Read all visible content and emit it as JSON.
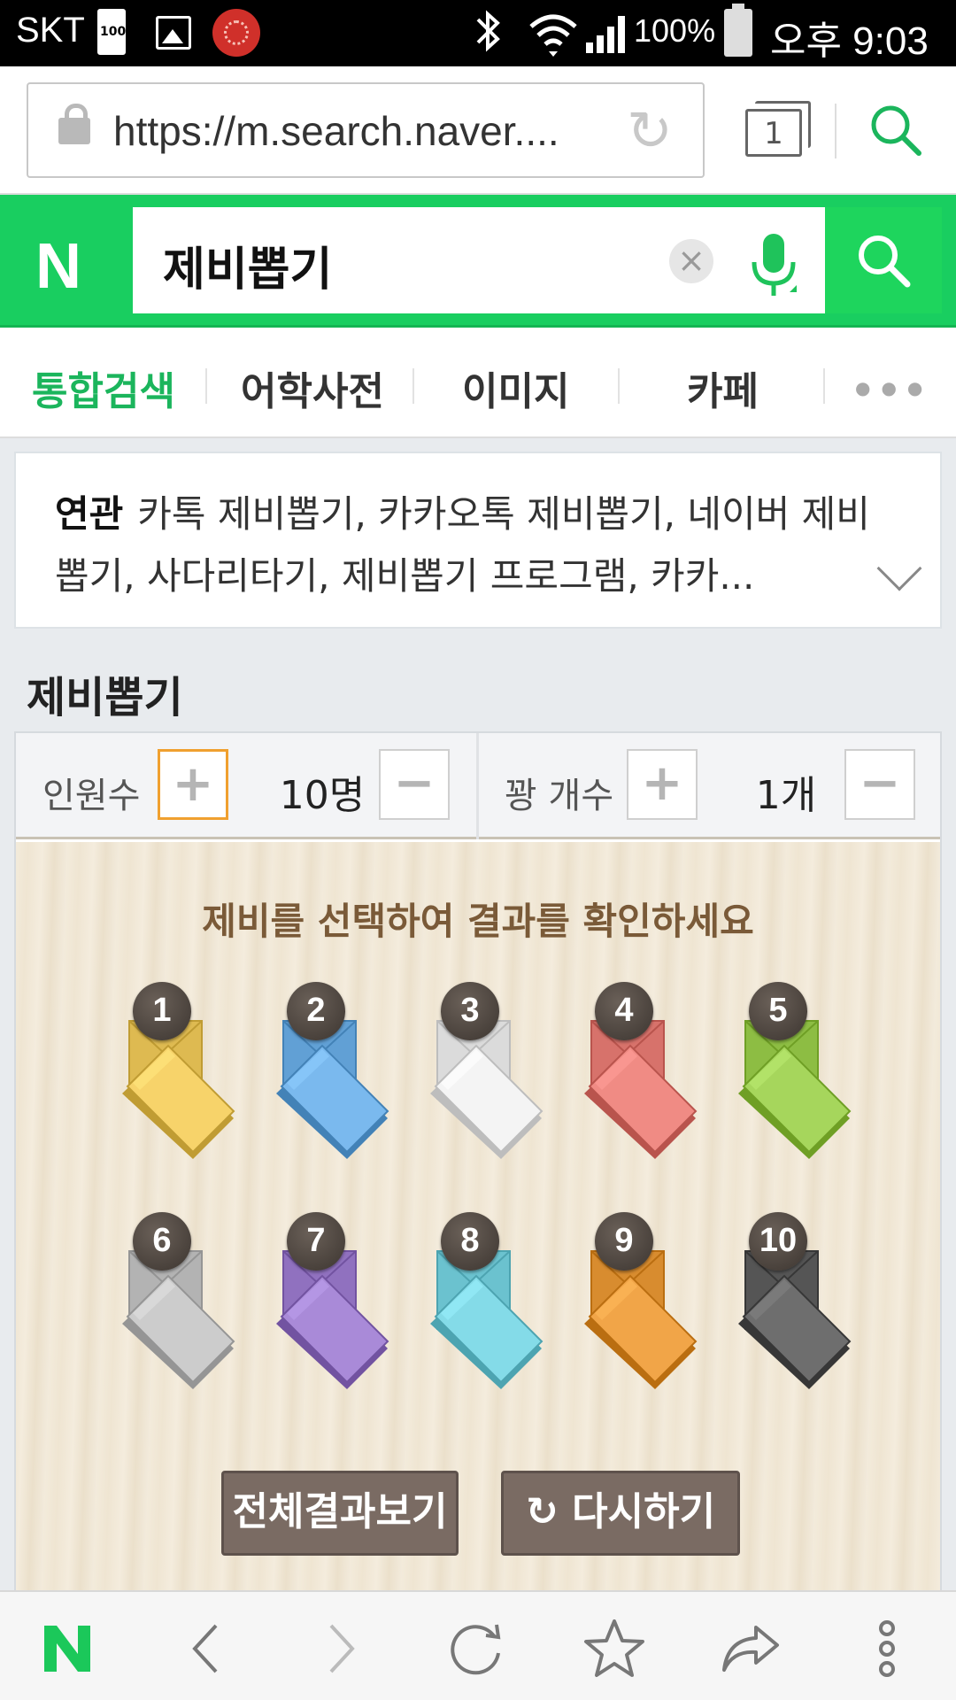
{
  "status_bar": {
    "carrier": "SKT",
    "battery_small": "100",
    "battery_percent": "100%",
    "time": "오후 9:03"
  },
  "browser": {
    "url": "https://m.search.naver....",
    "tab_count": "1"
  },
  "search": {
    "logo": "N",
    "query": "제비뽑기",
    "clear_icon": "×"
  },
  "category_tabs": [
    {
      "label": "통합검색",
      "active": true
    },
    {
      "label": "어학사전",
      "active": false
    },
    {
      "label": "이미지",
      "active": false
    },
    {
      "label": "카페",
      "active": false
    }
  ],
  "related": {
    "label": "연관",
    "text": "카톡 제비뽑기, 카카오톡 제비뽑기, 네이버 제비뽑기, 사다리타기, 제비뽑기 프로그램, 카카..."
  },
  "section_title": "제비뽑기",
  "controls": {
    "people_label": "인원수",
    "people_value": "10명",
    "prize_label": "꽝 개수",
    "prize_value": "1개",
    "plus": "+",
    "minus": "−"
  },
  "board": {
    "instruction": "제비를 선택하여 결과를 확인하세요",
    "swallows": [
      {
        "num": "1",
        "color": "#f7d36a"
      },
      {
        "num": "2",
        "color": "#7ab9ee"
      },
      {
        "num": "3",
        "color": "#f4f4f4"
      },
      {
        "num": "4",
        "color": "#f08b84"
      },
      {
        "num": "5",
        "color": "#a6d65c"
      },
      {
        "num": "6",
        "color": "#cccccc"
      },
      {
        "num": "7",
        "color": "#a98ad8"
      },
      {
        "num": "8",
        "color": "#84dbe8"
      },
      {
        "num": "9",
        "color": "#f1a548"
      },
      {
        "num": "10",
        "color": "#6e6e6e"
      }
    ],
    "show_all_label": "전체결과보기",
    "retry_label": "다시하기",
    "retry_icon": "↻"
  },
  "bottom_nav": [
    "naver-home",
    "back",
    "forward",
    "reload",
    "bookmark",
    "share",
    "more"
  ],
  "colors": {
    "naver_green": "#19ce60",
    "active_tab": "#1bb55c",
    "button": "#7a6b63"
  }
}
